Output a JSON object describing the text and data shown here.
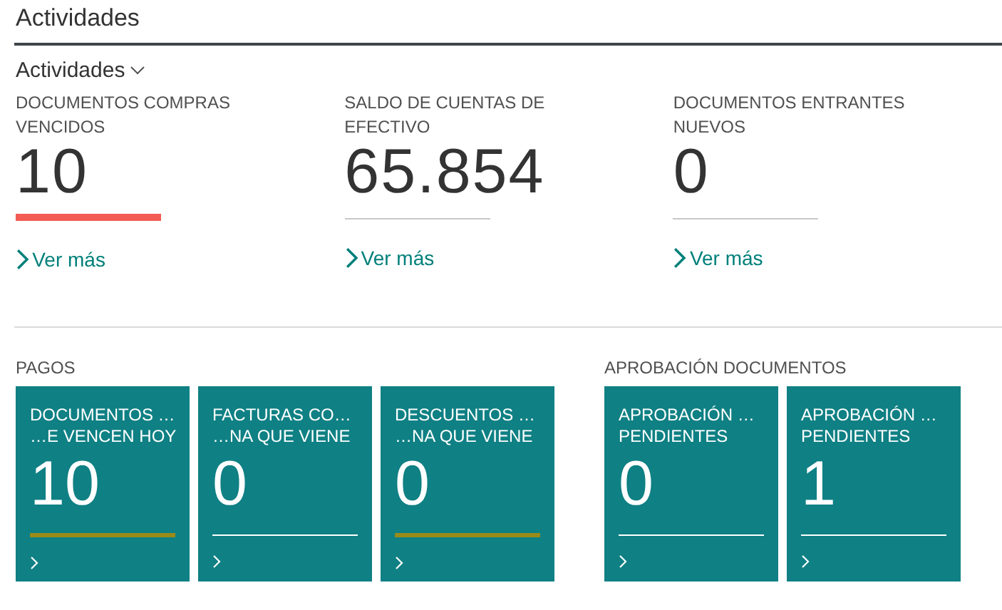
{
  "page_title": "Actividades",
  "group": {
    "title": "Actividades",
    "expanded": true
  },
  "cues": [
    {
      "label": "DOCUMENTOS COMPRAS VENCIDOS",
      "value": "10",
      "color": "#f25c54",
      "link": "Ver más"
    },
    {
      "label": "SALDO DE CUENTAS DE EFECTIVO",
      "value": "65.854",
      "color": "#c8c8c8",
      "link": "Ver más"
    },
    {
      "label": "DOCUMENTOS ENTRANTES NUEVOS",
      "value": "0",
      "color": "#c8c8c8",
      "link": "Ver más"
    }
  ],
  "sections": [
    {
      "title": "PAGOS",
      "tiles": [
        {
          "lines": [
            "DOCUMENTOS …",
            "…E VENCEN HOY"
          ],
          "value": "10",
          "color": "#9a8b1a"
        },
        {
          "lines": [
            "FACTURAS CO…",
            "…NA QUE VIENE"
          ],
          "value": "0",
          "color": "#ffffff"
        },
        {
          "lines": [
            "DESCUENTOS …",
            "…NA QUE VIENE"
          ],
          "value": "0",
          "color": "#9a8b1a"
        }
      ]
    },
    {
      "title": "APROBACIÓN DOCUMENTOS",
      "tiles": [
        {
          "lines": [
            "APROBACIÓN …",
            "PENDIENTES"
          ],
          "value": "0",
          "color": "#ffffff"
        },
        {
          "lines": [
            "APROBACIÓN …",
            "PENDIENTES"
          ],
          "value": "1",
          "color": "#ffffff"
        }
      ]
    }
  ]
}
